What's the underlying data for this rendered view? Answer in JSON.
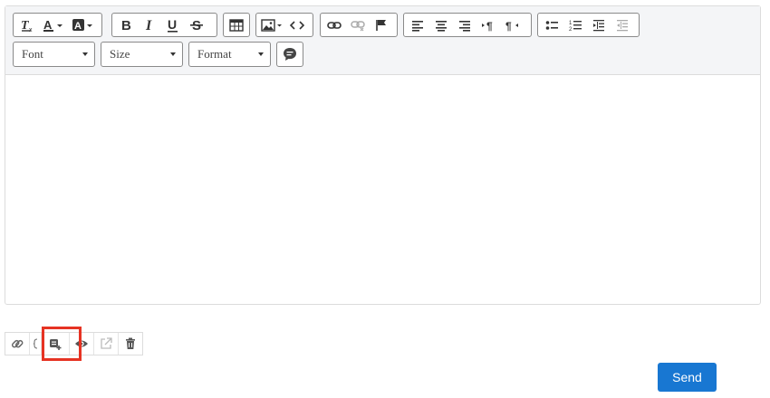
{
  "toolbar": {
    "groups": [
      {
        "name": "text-style",
        "buttons": [
          "clear-format-icon",
          "font-color-icon",
          "background-color-icon"
        ]
      },
      {
        "name": "font-style",
        "buttons": [
          "bold-icon",
          "italic-icon",
          "underline-icon",
          "strikethrough-icon"
        ]
      },
      {
        "name": "table",
        "buttons": [
          "table-icon"
        ]
      },
      {
        "name": "media",
        "buttons": [
          "image-icon",
          "code-view-icon"
        ]
      },
      {
        "name": "links",
        "buttons": [
          "link-icon",
          "unlink-icon",
          "flag-icon"
        ]
      },
      {
        "name": "alignment",
        "buttons": [
          "align-left-icon",
          "align-center-icon",
          "align-right-icon",
          "ltr-icon",
          "rtl-icon"
        ]
      },
      {
        "name": "lists",
        "buttons": [
          "bullet-list-icon",
          "numbered-list-icon",
          "indent-icon",
          "outdent-icon"
        ]
      }
    ],
    "font_select": "Font",
    "size_select": "Size",
    "format_select": "Format",
    "comment_icon": "comment-icon"
  },
  "attachments_bar": {
    "icons": [
      "link-icon",
      "add-document-icon",
      "preview-icon",
      "external-link-icon",
      "delete-icon"
    ]
  },
  "send_label": "Send"
}
